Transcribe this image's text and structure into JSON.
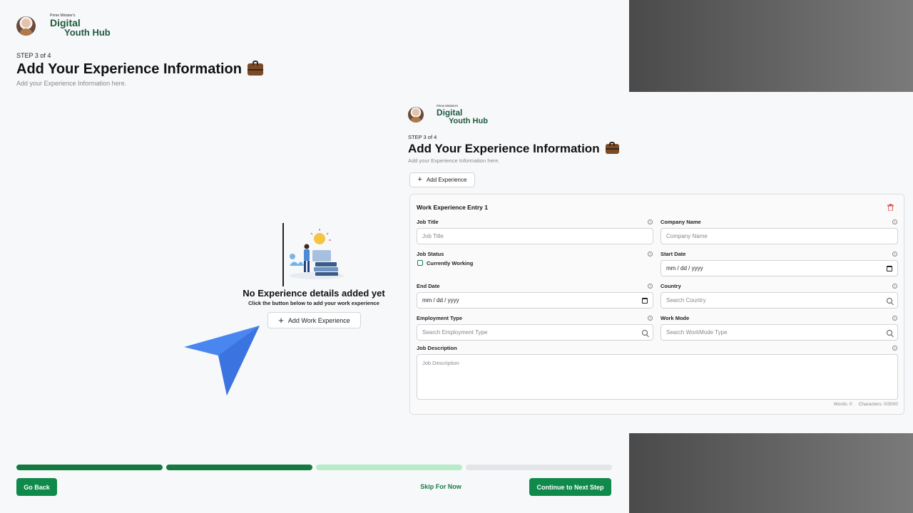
{
  "logo": {
    "prefix": "Prime Minister's",
    "line1": "Digital",
    "line2": "Youth Hub"
  },
  "page": {
    "step": "STEP 3 of 4",
    "title": "Add Your Experience Information",
    "subtitle": "Add your Experience Information here."
  },
  "empty_state": {
    "title": "No Experience details added yet",
    "subtitle": "Click the button below to add your work experience",
    "button": "Add Work Experience"
  },
  "footer": {
    "back": "Go Back",
    "skip": "Skip For Now",
    "continue": "Continue to Next Step",
    "progress": {
      "steps_total": 4,
      "completed": 2,
      "current": 3
    }
  },
  "form": {
    "add_button": "Add Experience",
    "entry_title": "Work Experience Entry 1",
    "fields": {
      "job_title": {
        "label": "Job Title",
        "placeholder": "Job Title"
      },
      "company_name": {
        "label": "Company Name",
        "placeholder": "Company Name"
      },
      "job_status": {
        "label": "Job Status",
        "checkbox": "Currently Working"
      },
      "start_date": {
        "label": "Start Date",
        "placeholder": "mm / dd / yyyy"
      },
      "end_date": {
        "label": "End Date",
        "placeholder": "mm / dd / yyyy"
      },
      "country": {
        "label": "Country",
        "placeholder": "Search Country"
      },
      "employment_type": {
        "label": "Employment Type",
        "placeholder": "Search Employment Type"
      },
      "work_mode": {
        "label": "Work Mode",
        "placeholder": "Search WorkMode Type"
      },
      "job_description": {
        "label": "Job Description",
        "placeholder": "Job Description"
      }
    },
    "counts": {
      "words": "Words: 0",
      "characters": "Characters: 0/3000"
    }
  },
  "colors": {
    "primary": "#0f8a4a",
    "progress_done": "#13793f",
    "progress_current": "#b8ecc9",
    "progress_todo": "#e3e5e8",
    "accent_cursor": "#4a86f0"
  }
}
